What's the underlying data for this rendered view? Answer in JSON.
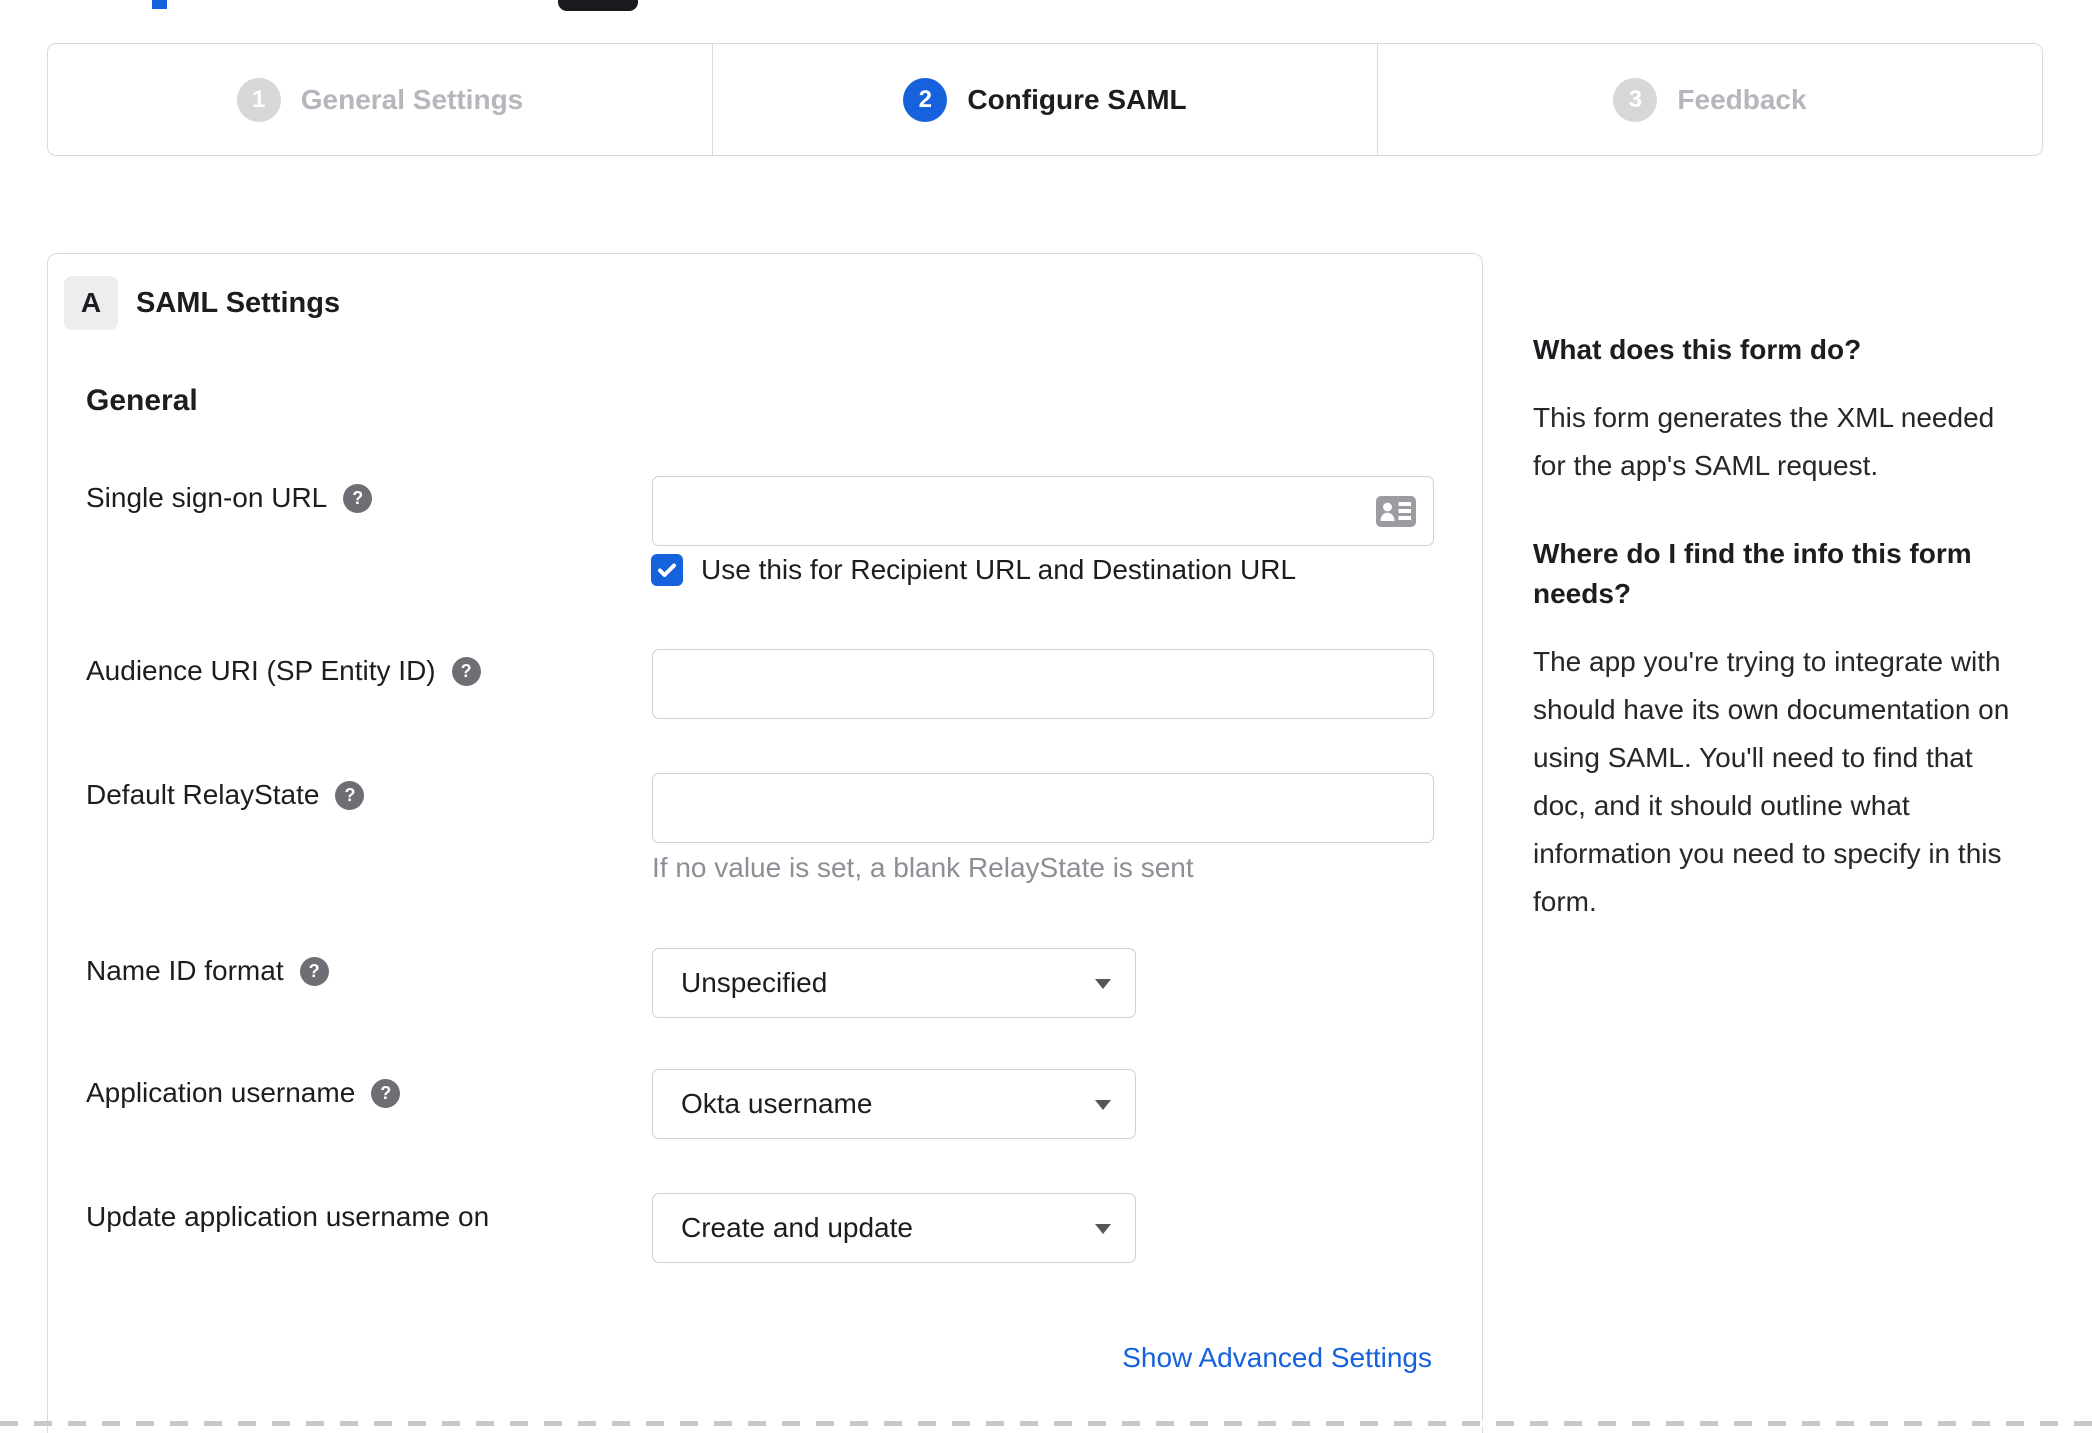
{
  "colors": {
    "accent_blue": "#1662dd",
    "inactive_gray": "#d7d7da",
    "border_gray": "#d9d9de",
    "hint_gray": "#8e8e96"
  },
  "stepper": {
    "steps": [
      {
        "number": "1",
        "label": "General Settings",
        "state": "inactive"
      },
      {
        "number": "2",
        "label": "Configure SAML",
        "state": "active"
      },
      {
        "number": "3",
        "label": "Feedback",
        "state": "inactive"
      }
    ]
  },
  "panel": {
    "section_badge": "A",
    "section_title": "SAML Settings",
    "group_heading": "General",
    "advanced_link_label": "Show Advanced Settings"
  },
  "fields": {
    "sso": {
      "label": "Single sign-on URL",
      "value": "",
      "icon": "contact-card-icon",
      "checkbox_label": "Use this for Recipient URL and Destination URL",
      "checkbox_checked": true
    },
    "audience": {
      "label": "Audience URI (SP Entity ID)",
      "value": ""
    },
    "relay": {
      "label": "Default RelayState",
      "value": "",
      "hint": "If no value is set, a blank RelayState is sent"
    },
    "name_id": {
      "label": "Name ID format",
      "value": "Unspecified"
    },
    "app_username": {
      "label": "Application username",
      "value": "Okta username"
    },
    "update_username": {
      "label": "Update application username on",
      "value": "Create and update"
    }
  },
  "help_panel": {
    "sections": [
      {
        "heading": "What does this form do?",
        "body": "This form generates the XML needed for the app's SAML request."
      },
      {
        "heading": "Where do I find the info this form needs?",
        "body": "The app you're trying to integrate with should have its own documentation on using SAML. You'll need to find that doc, and it should outline what information you need to specify in this form."
      }
    ]
  }
}
